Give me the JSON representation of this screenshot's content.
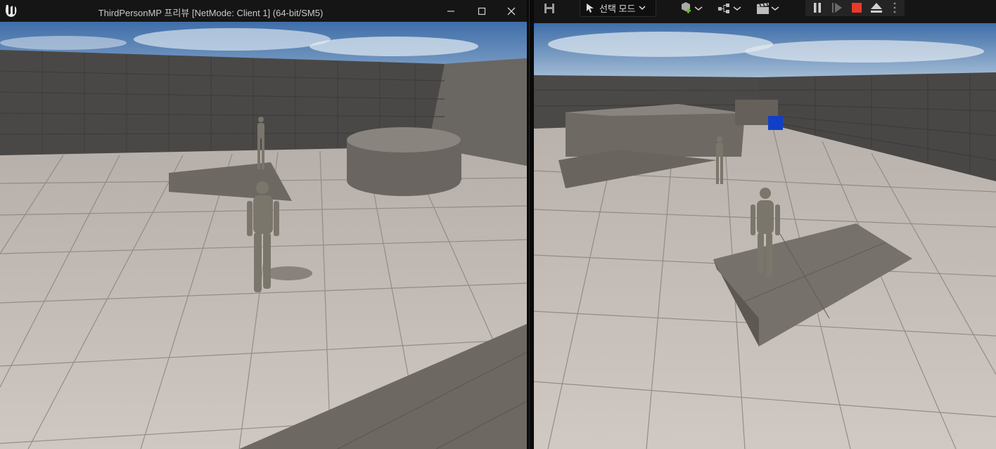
{
  "client_window": {
    "title": "ThirdPersonMP 프리뷰 [NetMode: Client 1]  (64-bit/SM5)",
    "logo": "unreal-engine-logo",
    "controls": [
      "minimize-icon",
      "maximize-icon",
      "close-icon"
    ]
  },
  "editor_toolbar": {
    "save_icon": "save-icon",
    "mode_label": "선택 모드",
    "mode_icon": "select-mode-icon",
    "add_icon": "add-actor-icon",
    "blueprint_icon": "blueprint-icon",
    "cinematics_icon": "clapperboard-icon",
    "play_controls": [
      "pause-icon",
      "step-frame-icon",
      "stop-icon",
      "eject-icon",
      "more-options-icon"
    ],
    "stop_color": "#e8392b"
  },
  "colors": {
    "sky_top": "#3f6ea8",
    "sky_bottom": "#a8c0d8",
    "floor": "#c4bcb6",
    "grid_line": "#a9a19b",
    "wall": "#4a4846",
    "ramp": "#6e6862",
    "mannequin": "#7b766c",
    "cube_blue": "#1140c8"
  }
}
